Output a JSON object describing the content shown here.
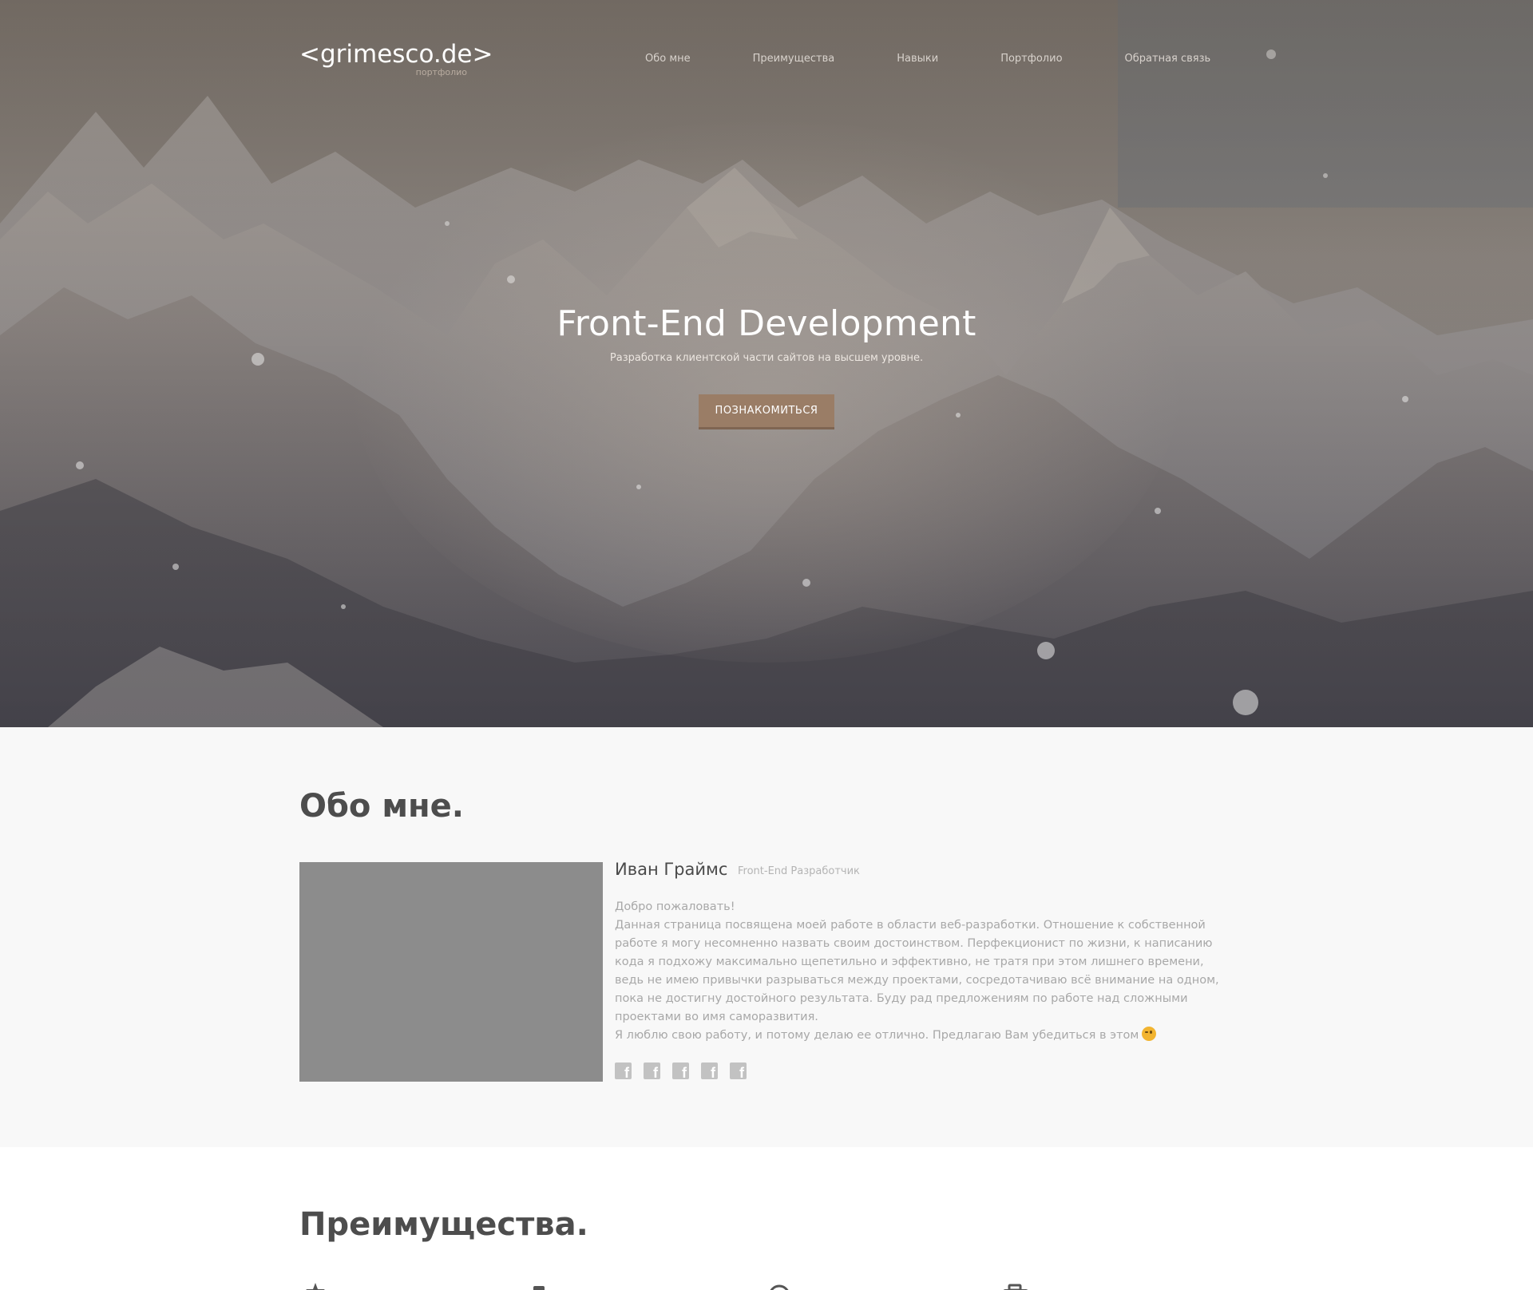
{
  "header": {
    "logo": "<grimesco.de>",
    "logo_sub": "портфолио",
    "nav": [
      "Обо мне",
      "Преимущества",
      "Навыки",
      "Портфолио",
      "Обратная связь"
    ]
  },
  "hero": {
    "title": "Front-End Development",
    "subtitle": "Разработка клиентской части сайтов на высшем уровне.",
    "button": "ПОЗНАКОМИТЬСЯ"
  },
  "about": {
    "title": "Обо мне.",
    "name": "Иван Граймс",
    "role": "Front-End Разработчик",
    "paragraphs": [
      "Добро пожаловать!",
      "Данная страница посвящена моей работе в области веб-разработки. Отношение к собственной работе я могу несомненно назвать своим достоинством. Перфекционист по жизни, к написанию кода я подхожу максимально щепетильно и эффективно, не тратя при этом лишнего времени, ведь не имею привычки разрываться между проектами, сосредотачиваю всё внимание на одном, пока не достигну достойного результата. Буду рад предложениям по работе над сложными проектами во имя саморазвития.",
      "Я люблю свою работу, и потому делаю ее отлично. Предлагаю Вам убедиться в этом"
    ],
    "social_icons": [
      "facebook-icon",
      "facebook-icon",
      "facebook-icon",
      "facebook-icon",
      "facebook-icon"
    ]
  },
  "advantages": {
    "title": "Преимущества.",
    "icons": [
      "star-icon",
      "mobile-icon",
      "globe-icon",
      "briefcase-icon"
    ]
  },
  "colors": {
    "accent": "#9a7d66",
    "heading": "#4d4d4d",
    "text_muted": "#a8a8a8",
    "photo_placeholder": "#8c8c8c"
  }
}
